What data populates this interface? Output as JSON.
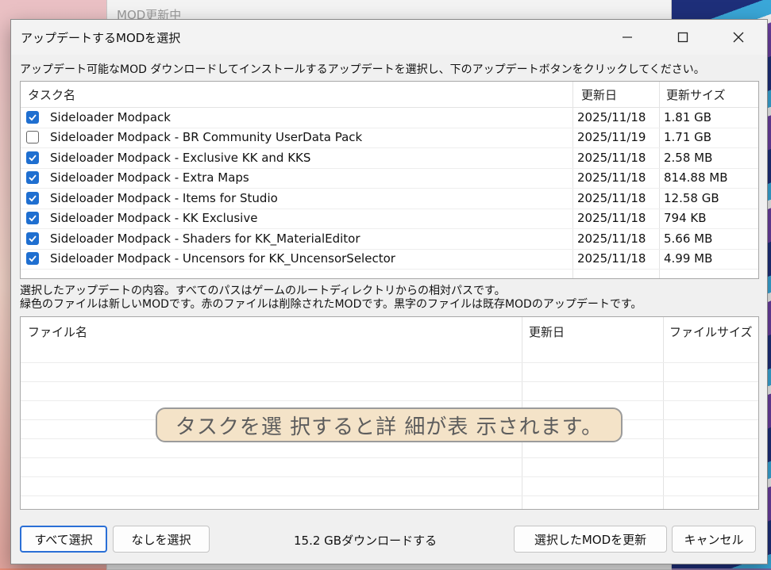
{
  "background": {
    "window_title": "MOD更新中"
  },
  "dialog": {
    "title": "アップデートするMODを選択",
    "instruction": "アップデート可能なMOD ダウンロードしてインストールするアップデートを選択し、下のアップデートボタンをクリックしてください。",
    "update_list": {
      "columns": [
        "タスク名",
        "更新日",
        "更新サイズ"
      ],
      "rows": [
        {
          "checked": true,
          "name": "Sideloader Modpack",
          "date": "2025/11/18",
          "size": "1.81 GB"
        },
        {
          "checked": false,
          "name": "Sideloader Modpack - BR Community UserData Pack",
          "date": "2025/11/19",
          "size": "1.71 GB"
        },
        {
          "checked": true,
          "name": "Sideloader Modpack - Exclusive KK and KKS",
          "date": "2025/11/18",
          "size": "2.58 MB"
        },
        {
          "checked": true,
          "name": "Sideloader Modpack - Extra Maps",
          "date": "2025/11/18",
          "size": "814.88 MB"
        },
        {
          "checked": true,
          "name": "Sideloader Modpack - Items for Studio",
          "date": "2025/11/18",
          "size": "12.58 GB"
        },
        {
          "checked": true,
          "name": "Sideloader Modpack - KK Exclusive",
          "date": "2025/11/18",
          "size": "794 KB"
        },
        {
          "checked": true,
          "name": "Sideloader Modpack - Shaders for KK_MaterialEditor",
          "date": "2025/11/18",
          "size": "5.66 MB"
        },
        {
          "checked": true,
          "name": "Sideloader Modpack - Uncensors for KK_UncensorSelector",
          "date": "2025/11/18",
          "size": "4.99 MB"
        }
      ]
    },
    "description_line1": "選択したアップデートの内容。すべてのパスはゲームのルートディレクトリからの相対パスです。",
    "description_line2": "緑色のファイルは新しいMODです。赤のファイルは削除されたMODです。黒字のファイルは既存MODのアップデートです。",
    "file_list": {
      "columns": [
        "ファイル名",
        "更新日",
        "ファイルサイズ"
      ],
      "placeholder": "タスクを選 択すると詳 細が表 示されます。"
    },
    "buttons": {
      "select_all": "すべて選択",
      "select_none": "なしを選択",
      "update_selected": "選択したMODを更新",
      "cancel": "キャンセル"
    },
    "download_status": "15.2 GBダウンロードする"
  },
  "colors": {
    "checkbox_accent": "#1f6fd0",
    "primary_button_border": "#2a6fd6"
  }
}
